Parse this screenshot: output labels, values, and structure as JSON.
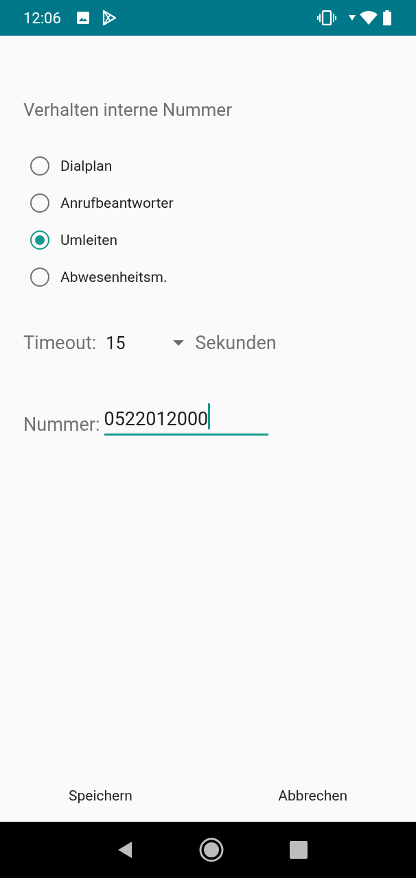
{
  "status_bar": {
    "time": "12:06"
  },
  "title": "Verhalten interne Nummer",
  "options": [
    {
      "label": "Dialplan",
      "selected": false
    },
    {
      "label": "Anrufbeantworter",
      "selected": false
    },
    {
      "label": "Umleiten",
      "selected": true
    },
    {
      "label": "Abwesenheitsm.",
      "selected": false
    }
  ],
  "timeout": {
    "label": "Timeout:",
    "value": "15",
    "unit": "Sekunden"
  },
  "number": {
    "label": "Nummer:",
    "value": "0522012000"
  },
  "buttons": [
    "Speichern",
    "Abbrechen"
  ]
}
